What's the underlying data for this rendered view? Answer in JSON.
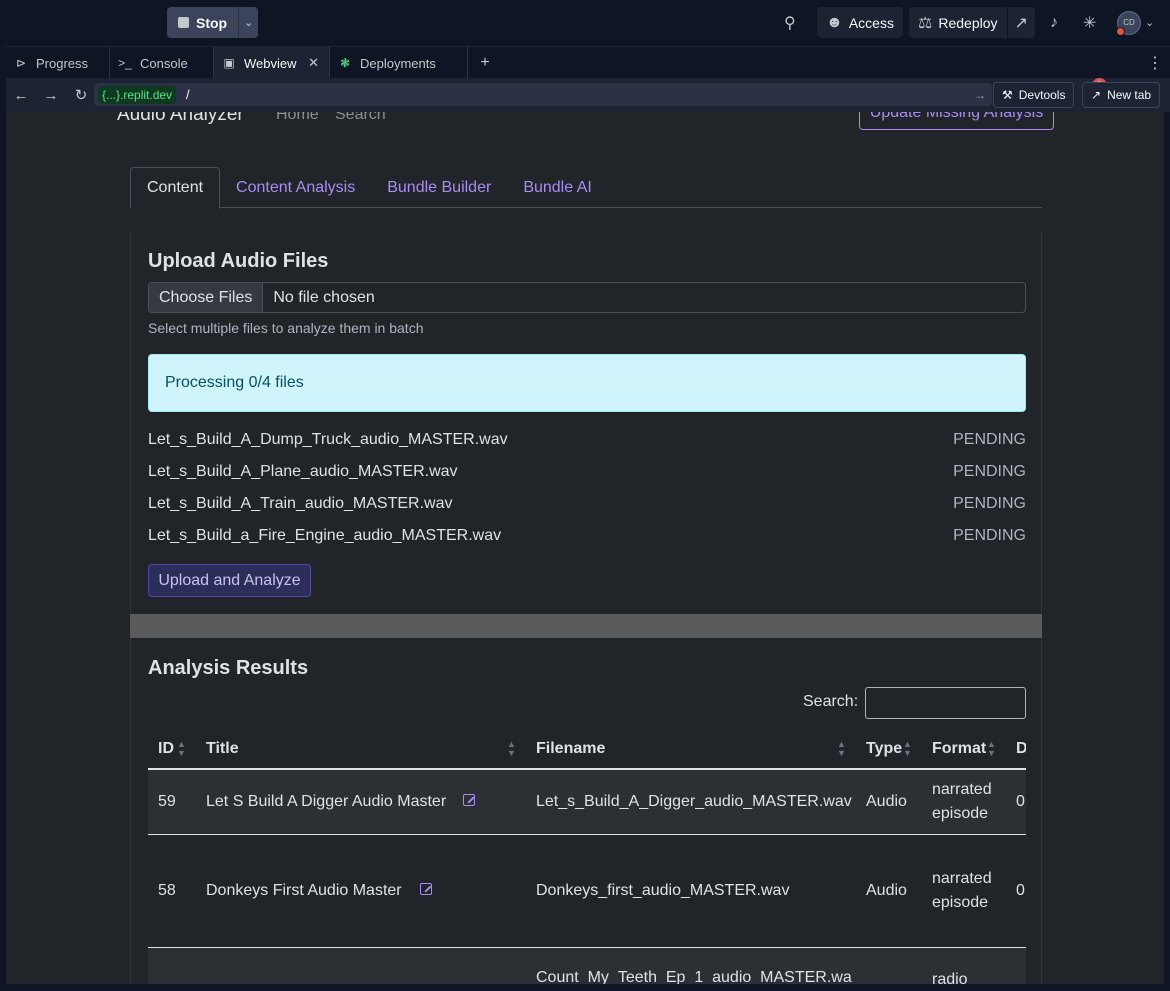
{
  "topbar": {
    "stop_label": "Stop",
    "access_label": "Access",
    "redeploy_label": "Redeploy",
    "avatar_initials": "CD"
  },
  "tabs": [
    {
      "label": "Progress",
      "icon": "progress-icon"
    },
    {
      "label": "Console",
      "icon": "terminal-icon"
    },
    {
      "label": "Webview",
      "icon": "monitor-icon"
    },
    {
      "label": "Deployments",
      "icon": "deploy-icon"
    }
  ],
  "urlbar": {
    "host": "{...}.replit.dev",
    "path": "/",
    "devtools_label": "Devtools",
    "devtools_badge": "1",
    "newtab_label": "New tab"
  },
  "app": {
    "title": "Audio Analyzer",
    "nav_home": "Home",
    "nav_search": "Search",
    "update_button": "Update Missing Analysis",
    "content_tabs": [
      "Content",
      "Content Analysis",
      "Bundle Builder",
      "Bundle AI"
    ]
  },
  "upload": {
    "title": "Upload Audio Files",
    "choose_label": "Choose Files",
    "no_file": "No file chosen",
    "help": "Select multiple files to analyze them in batch",
    "processing": "Processing 0/4 files",
    "files": [
      {
        "name": "Let_s_Build_A_Dump_Truck_audio_MASTER.wav",
        "status": "PENDING"
      },
      {
        "name": "Let_s_Build_A_Plane_audio_MASTER.wav",
        "status": "PENDING"
      },
      {
        "name": "Let_s_Build_A_Train_audio_MASTER.wav",
        "status": "PENDING"
      },
      {
        "name": "Let_s_Build_a_Fire_Engine_audio_MASTER.wav",
        "status": "PENDING"
      }
    ],
    "button": "Upload and Analyze"
  },
  "results": {
    "title": "Analysis Results",
    "search_label": "Search:",
    "columns": [
      "ID",
      "Title",
      "Filename",
      "Type",
      "Format",
      "D"
    ],
    "rows": [
      {
        "id": "59",
        "title": "Let S Build A Digger Audio Master",
        "filename": "Let_s_Build_A_Digger_audio_MASTER.wav",
        "type": "Audio",
        "format1": "narrated",
        "format2": "episode",
        "d": "0"
      },
      {
        "id": "58",
        "title": "Donkeys First Audio Master",
        "filename": "Donkeys_first_audio_MASTER.wav",
        "type": "Audio",
        "format1": "narrated",
        "format2": "episode",
        "d": "0"
      },
      {
        "id": "",
        "title": "",
        "filename": "Count_My_Teeth_Ep_1_audio_MASTER.wa",
        "type": "",
        "format1": "radio",
        "format2": "",
        "d": ""
      }
    ]
  }
}
